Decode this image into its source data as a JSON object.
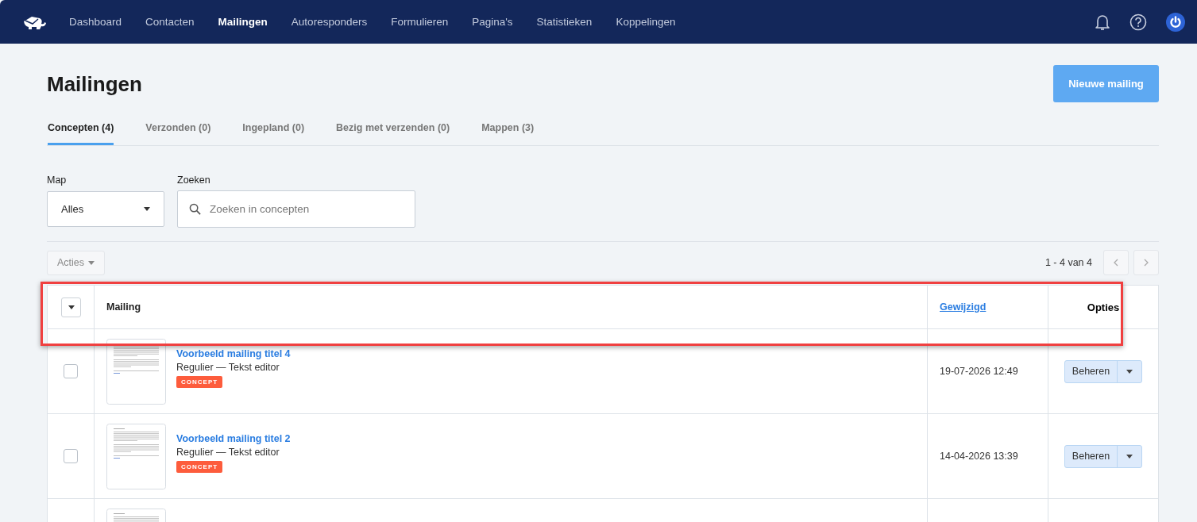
{
  "nav": {
    "items": [
      {
        "label": "Dashboard",
        "selected": false
      },
      {
        "label": "Contacten",
        "selected": false
      },
      {
        "label": "Mailingen",
        "selected": true
      },
      {
        "label": "Autoresponders",
        "selected": false
      },
      {
        "label": "Formulieren",
        "selected": false
      },
      {
        "label": "Pagina's",
        "selected": false
      },
      {
        "label": "Statistieken",
        "selected": false
      },
      {
        "label": "Koppelingen",
        "selected": false
      }
    ]
  },
  "page": {
    "title": "Mailingen",
    "primary_button": "Nieuwe mailing"
  },
  "tabs": [
    {
      "label": "Concepten (4)",
      "selected": true
    },
    {
      "label": "Verzonden (0)",
      "selected": false
    },
    {
      "label": "Ingepland (0)",
      "selected": false
    },
    {
      "label": "Bezig met verzenden (0)",
      "selected": false
    },
    {
      "label": "Mappen (3)",
      "selected": false
    }
  ],
  "filters": {
    "folder": {
      "label": "Map",
      "value": "Alles"
    },
    "search": {
      "label": "Zoeken",
      "placeholder": "Zoeken in concepten"
    }
  },
  "toolbar": {
    "actions": "Acties",
    "range": "1 - 4 van 4"
  },
  "table": {
    "columns": [
      "Mailing",
      "Gewijzigd",
      "Opties"
    ],
    "rows": [
      {
        "kind": "full",
        "checked": false,
        "title": "Voorbeeld mailing titel 4",
        "subtitle": "Regulier — Tekst editor",
        "badge": "CONCEPT",
        "modified": "19-07-2026 12:49",
        "action": "Beheren"
      },
      {
        "kind": "full",
        "checked": false,
        "title": "Voorbeeld mailing titel 2",
        "subtitle": "Regulier — Tekst editor",
        "badge": "CONCEPT",
        "modified": "14-04-2026 13:39",
        "action": "Beheren"
      },
      {
        "kind": "cut"
      }
    ]
  }
}
